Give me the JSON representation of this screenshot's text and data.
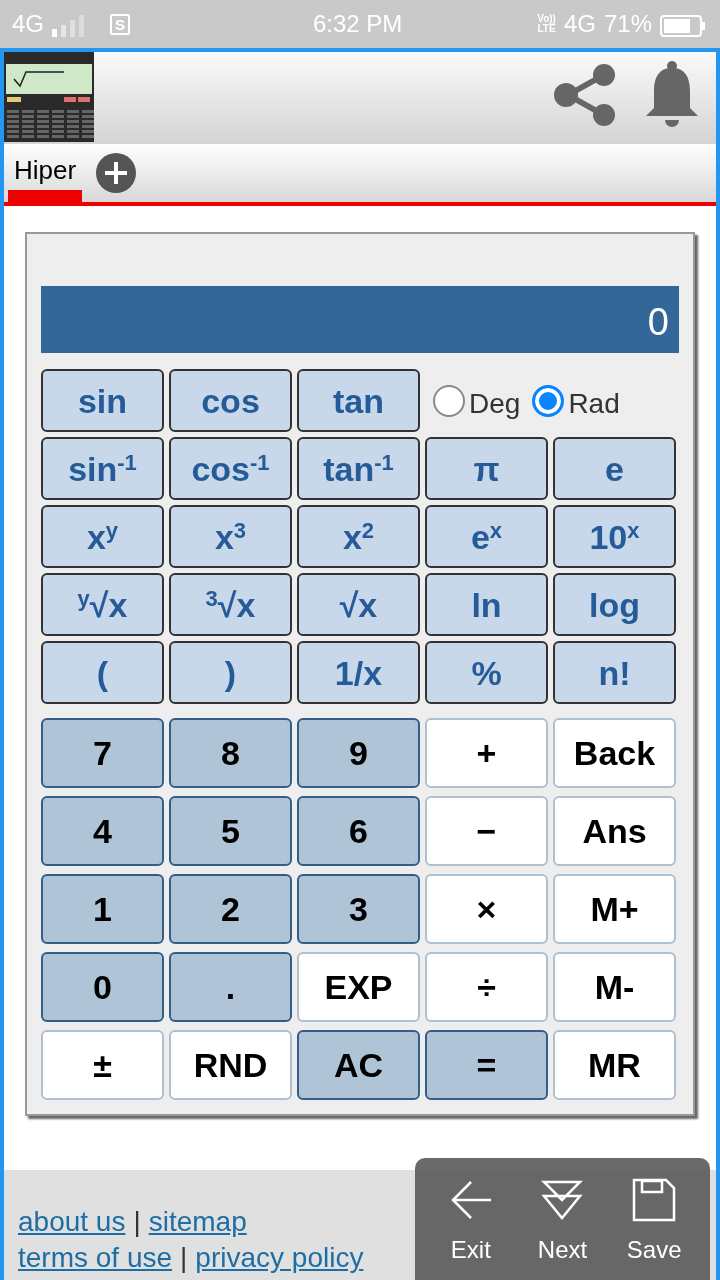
{
  "status_bar": {
    "network": "4G",
    "sim_label": "S",
    "time": "6:32 PM",
    "volte": [
      "Vo))",
      "LTE"
    ],
    "data_network": "4G",
    "battery": "71%"
  },
  "tabs": [
    {
      "label": "Hiper",
      "selected": true
    }
  ],
  "calculator": {
    "display": "0",
    "angle_modes": [
      {
        "label": "Deg",
        "selected": false
      },
      {
        "label": "Rad",
        "selected": true
      }
    ],
    "function_rows": [
      {
        "keys": [
          "sin",
          "cos",
          "tan"
        ]
      },
      {
        "keys": [
          "sin$^{-1}$",
          "cos$^{-1}$",
          "tan$^{-1}$",
          "π",
          "e"
        ]
      },
      {
        "keys": [
          "x$^{y}$",
          "x$^{3}$",
          "x$^{2}$",
          "e$^{x}$",
          "10$^{x}$"
        ]
      },
      {
        "keys": [
          "$^{y}$√x",
          "$^{3}$√x",
          "√x",
          "ln",
          "log"
        ]
      },
      {
        "keys": [
          "(",
          ")",
          "1/x",
          "%",
          "n!"
        ]
      }
    ],
    "keypad_rows": [
      [
        {
          "label": "7",
          "kind": "dark"
        },
        {
          "label": "8",
          "kind": "dark"
        },
        {
          "label": "9",
          "kind": "dark"
        },
        {
          "label": "+",
          "kind": "light"
        },
        {
          "label": "Back",
          "kind": "light"
        }
      ],
      [
        {
          "label": "4",
          "kind": "dark"
        },
        {
          "label": "5",
          "kind": "dark"
        },
        {
          "label": "6",
          "kind": "dark"
        },
        {
          "label": "−",
          "kind": "light"
        },
        {
          "label": "Ans",
          "kind": "light"
        }
      ],
      [
        {
          "label": "1",
          "kind": "dark"
        },
        {
          "label": "2",
          "kind": "dark"
        },
        {
          "label": "3",
          "kind": "dark"
        },
        {
          "label": "×",
          "kind": "light"
        },
        {
          "label": "M+",
          "kind": "light"
        }
      ],
      [
        {
          "label": "0",
          "kind": "dark"
        },
        {
          "label": ".",
          "kind": "dark"
        },
        {
          "label": "EXP",
          "kind": "light"
        },
        {
          "label": "÷",
          "kind": "light"
        },
        {
          "label": "M-",
          "kind": "light"
        }
      ],
      [
        {
          "label": "±",
          "kind": "light"
        },
        {
          "label": "RND",
          "kind": "light"
        },
        {
          "label": "AC",
          "kind": "dark"
        },
        {
          "label": "=",
          "kind": "dark"
        },
        {
          "label": "MR",
          "kind": "light"
        }
      ]
    ]
  },
  "footer": {
    "rows": [
      {
        "links": [
          "about us",
          "sitemap"
        ],
        "separator": "|"
      },
      {
        "links": [
          "terms of use",
          "privacy policy"
        ],
        "separator": "|"
      }
    ]
  },
  "overlay_actions": [
    {
      "label": "Exit"
    },
    {
      "label": "Next"
    },
    {
      "label": "Save"
    }
  ]
}
